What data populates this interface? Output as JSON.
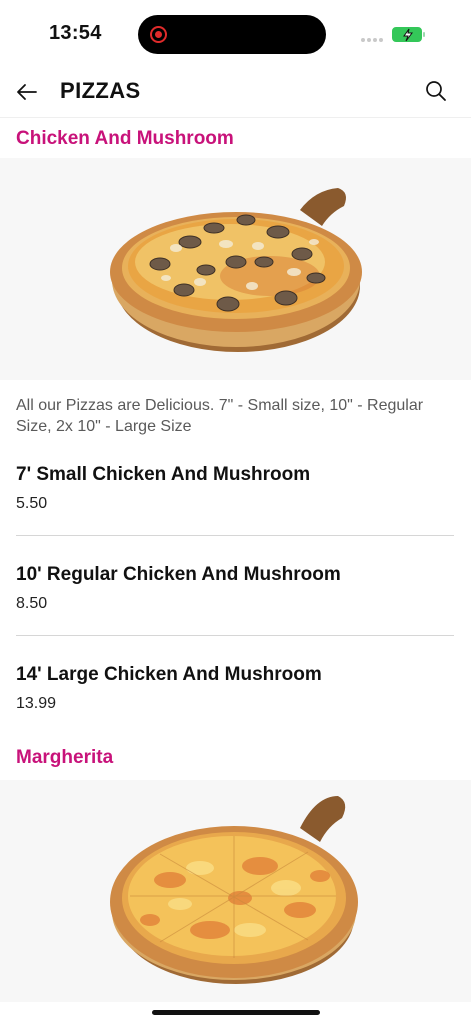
{
  "status_bar": {
    "time": "13:54"
  },
  "header": {
    "title": "PIZZAS"
  },
  "sections": [
    {
      "title": "Chicken And Mushroom",
      "description": "All our Pizzas are Delicious. 7\" - Small size, 10\" - Regular Size, 2x 10\" - Large Size",
      "items": [
        {
          "name": "7' Small Chicken And Mushroom",
          "price": "5.50"
        },
        {
          "name": "10' Regular Chicken And Mushroom",
          "price": "8.50"
        },
        {
          "name": "14' Large Chicken And Mushroom",
          "price": "13.99"
        }
      ]
    },
    {
      "title": "Margherita"
    }
  ],
  "colors": {
    "accent": "#c8127a",
    "battery": "#34c759",
    "recording": "#e02b2b"
  },
  "icons": {
    "back": "arrow-left-icon",
    "search": "search-icon"
  }
}
